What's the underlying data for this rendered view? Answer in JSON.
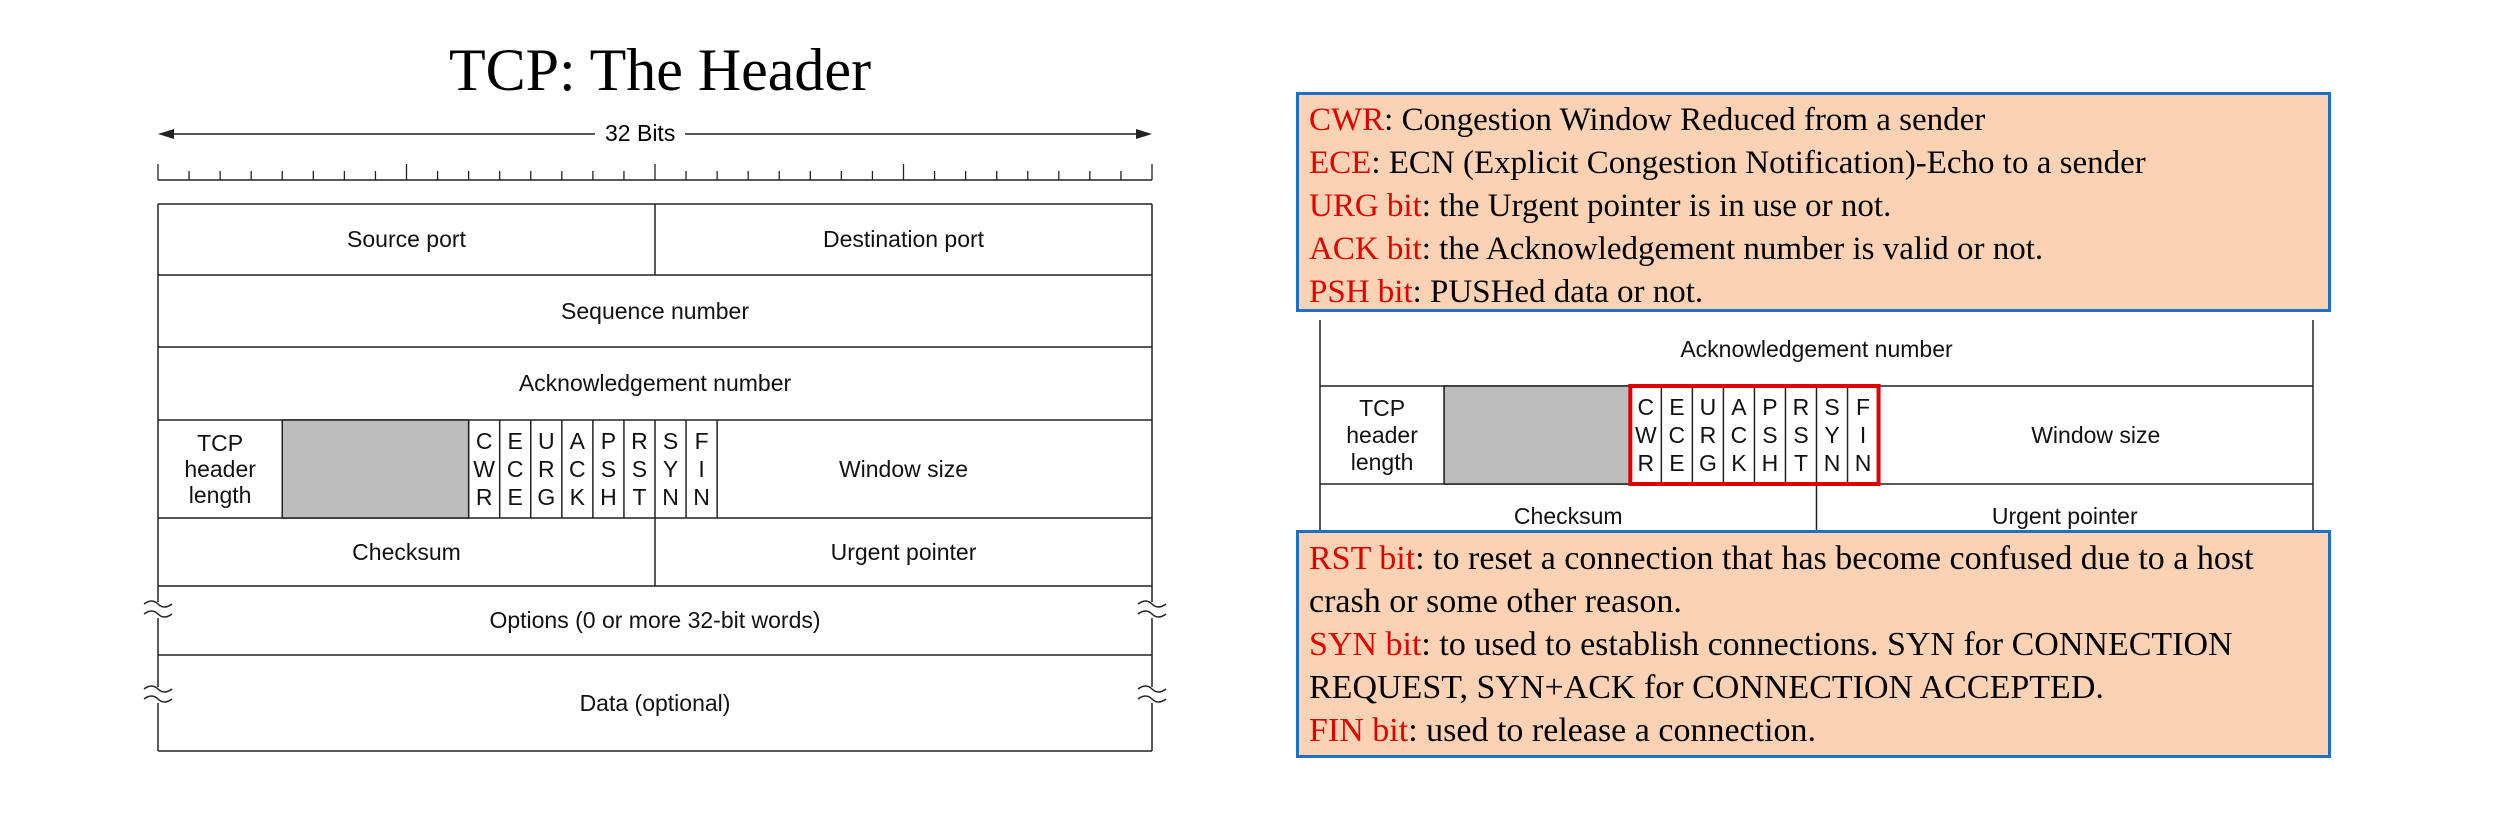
{
  "title": "TCP: The Header",
  "header_diagram": {
    "width_label": "32 Bits",
    "source_port": "Source port",
    "destination_port": "Destination port",
    "sequence_number": "Sequence number",
    "acknowledgement_number": "Acknowledgement number",
    "tcp_header_length": [
      "TCP",
      "header",
      "length"
    ],
    "flags": [
      {
        "id": "cwr",
        "letters": [
          "C",
          "W",
          "R"
        ]
      },
      {
        "id": "ece",
        "letters": [
          "E",
          "C",
          "E"
        ]
      },
      {
        "id": "urg",
        "letters": [
          "U",
          "R",
          "G"
        ]
      },
      {
        "id": "ack",
        "letters": [
          "A",
          "C",
          "K"
        ]
      },
      {
        "id": "psh",
        "letters": [
          "P",
          "S",
          "H"
        ]
      },
      {
        "id": "rst",
        "letters": [
          "R",
          "S",
          "T"
        ]
      },
      {
        "id": "syn",
        "letters": [
          "S",
          "Y",
          "N"
        ]
      },
      {
        "id": "fin",
        "letters": [
          "F",
          "I",
          "N"
        ]
      }
    ],
    "window_size": "Window size",
    "checksum": "Checksum",
    "urgent_pointer": "Urgent pointer",
    "options": "Options (0 or more 32-bit words)",
    "data": "Data (optional)"
  },
  "notes": {
    "top": [
      {
        "term": "CWR",
        "text": ": Congestion Window Reduced from a sender"
      },
      {
        "term": "ECE",
        "text": ": ECN (Explicit Congestion Notification)-Echo to a sender"
      },
      {
        "term": "URG bit",
        "text": ": the Urgent pointer is in use or not."
      },
      {
        "term": "ACK bit",
        "text": ": the Acknowledgement number is valid or not."
      },
      {
        "term": "PSH bit",
        "text": ": PUSHed data or not."
      }
    ],
    "bottom": [
      {
        "term": "RST bit",
        "text": ": to reset a connection that has become confused due to a host"
      },
      {
        "term": "",
        "text": "crash or some other reason."
      },
      {
        "term": "SYN bit",
        "text": ": to used to establish connections. SYN for CONNECTION"
      },
      {
        "term": "",
        "text": "REQUEST,  SYN+ACK for CONNECTION ACCEPTED."
      },
      {
        "term": "FIN bit",
        "text": ": used to release a connection."
      }
    ]
  },
  "colors": {
    "note_fill": "#fbd3b4",
    "note_border": "#1f6fc4",
    "term_red": "#e10000",
    "highlight_red": "#e00000",
    "reserved_gray": "#bdbdbd"
  }
}
